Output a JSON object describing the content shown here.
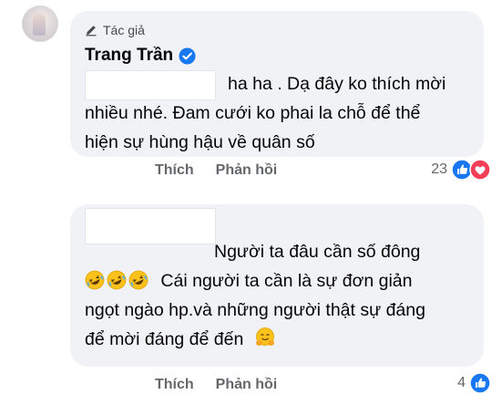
{
  "comment1": {
    "author_badge": "Tác giả",
    "author_name": "Trang Trần",
    "line1": "ha ha . Dạ đây ko thích mời",
    "line2": "nhiều nhé. Đam cưới ko phai la chỗ để thể",
    "line3": "hiện sự hùng hậu về quân số",
    "like_label": "Thích",
    "reply_label": "Phản hồi",
    "reaction_count": "23",
    "reactions": [
      "like-icon",
      "love-icon"
    ]
  },
  "comment2": {
    "line1": "Người ta đâu cần số đông",
    "line2": "Cái người ta cần là sự đơn giản",
    "line3": "ngọt ngào hp.và những người thật sự đáng",
    "line4": "để mời đáng để đến",
    "line2_emojis": [
      "rofl-emoji",
      "rofl-emoji",
      "rofl-emoji"
    ],
    "line4_emoji": "hugging-emoji",
    "like_label": "Thích",
    "reply_label": "Phản hồi",
    "reaction_count": "4",
    "reactions": [
      "like-icon"
    ]
  },
  "colors": {
    "bubble_bg": "#f0f2f5",
    "meta_text": "#65676b",
    "like_blue": "#1877f2",
    "love_red": "#f33e58"
  }
}
